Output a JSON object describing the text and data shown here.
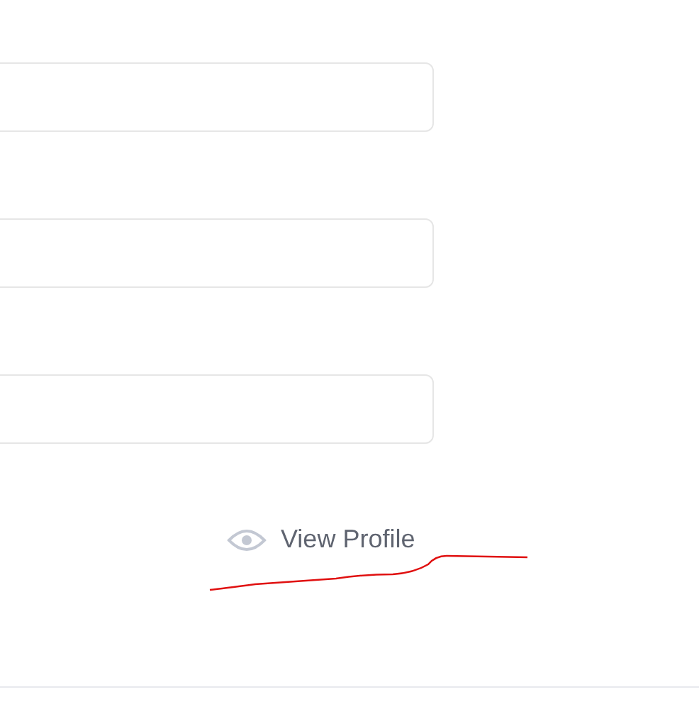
{
  "fields": [
    {
      "kind": "text"
    },
    {
      "kind": "text"
    },
    {
      "kind": "text"
    }
  ],
  "view_profile_link": {
    "label": "View Profile"
  }
}
